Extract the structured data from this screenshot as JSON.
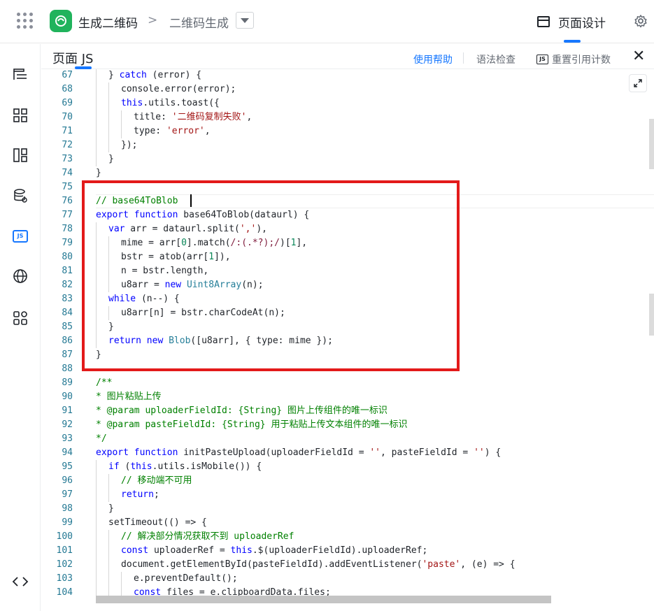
{
  "topbar": {
    "app_name": "生成二维码",
    "breadcrumb_sep": ">",
    "page_name": "二维码生成",
    "design_tab": "页面设计"
  },
  "editor": {
    "title": "页面 JS",
    "help": "使用帮助",
    "lint": "语法检查",
    "js_badge": "JS",
    "reset_ref": "重置引用计数"
  },
  "sidebar": {
    "items": [
      "outline-icon",
      "components-icon",
      "layout-icon",
      "datasource-icon",
      "js-icon",
      "globe-icon",
      "apps-icon",
      "code-icon"
    ],
    "js_label": "JS"
  },
  "colors": {
    "accent": "#1677ff",
    "logo": "#20b35c",
    "highlight_box": "#e31a1a"
  },
  "code_lines": [
    {
      "n": "67",
      "indent": 1,
      "tokens": [
        [
          "p",
          "} "
        ],
        [
          "kw",
          "catch"
        ],
        [
          "p",
          " (error) {"
        ]
      ]
    },
    {
      "n": "68",
      "indent": 2,
      "tokens": [
        [
          "p",
          "console.error(error);"
        ]
      ]
    },
    {
      "n": "69",
      "indent": 2,
      "tokens": [
        [
          "th",
          "this"
        ],
        [
          "p",
          ".utils.toast({"
        ]
      ]
    },
    {
      "n": "70",
      "indent": 3,
      "tokens": [
        [
          "p",
          "title: "
        ],
        [
          "str",
          "'二维码复制失败'"
        ],
        [
          "p",
          ","
        ]
      ]
    },
    {
      "n": "71",
      "indent": 3,
      "tokens": [
        [
          "p",
          "type: "
        ],
        [
          "str",
          "'error'"
        ],
        [
          "p",
          ","
        ]
      ]
    },
    {
      "n": "72",
      "indent": 2,
      "tokens": [
        [
          "p",
          "});"
        ]
      ]
    },
    {
      "n": "73",
      "indent": 1,
      "tokens": [
        [
          "p",
          "}"
        ]
      ]
    },
    {
      "n": "74",
      "indent": 0,
      "tokens": [
        [
          "p",
          "}"
        ]
      ]
    },
    {
      "n": "75",
      "indent": 0,
      "tokens": []
    },
    {
      "n": "76",
      "indent": 0,
      "tokens": [
        [
          "cm",
          "// base64ToBlob"
        ]
      ],
      "current": true
    },
    {
      "n": "77",
      "indent": 0,
      "tokens": [
        [
          "kw",
          "export"
        ],
        [
          "p",
          " "
        ],
        [
          "kw",
          "function"
        ],
        [
          "p",
          " base64ToBlob(dataurl) {"
        ]
      ]
    },
    {
      "n": "78",
      "indent": 1,
      "tokens": [
        [
          "kw",
          "var"
        ],
        [
          "p",
          " arr = dataurl.split("
        ],
        [
          "str",
          "','"
        ],
        [
          "p",
          "),"
        ]
      ]
    },
    {
      "n": "79",
      "indent": 2,
      "tokens": [
        [
          "p",
          "mime = arr["
        ],
        [
          "nm",
          "0"
        ],
        [
          "p",
          "].match("
        ],
        [
          "rx",
          "/:(.*?);/"
        ],
        [
          "p",
          ")["
        ],
        [
          "nm",
          "1"
        ],
        [
          "p",
          "],"
        ]
      ]
    },
    {
      "n": "80",
      "indent": 2,
      "tokens": [
        [
          "p",
          "bstr = atob(arr["
        ],
        [
          "nm",
          "1"
        ],
        [
          "p",
          "]),"
        ]
      ]
    },
    {
      "n": "81",
      "indent": 2,
      "tokens": [
        [
          "p",
          "n = bstr.length,"
        ]
      ]
    },
    {
      "n": "82",
      "indent": 2,
      "tokens": [
        [
          "p",
          "u8arr = "
        ],
        [
          "kw",
          "new"
        ],
        [
          "p",
          " "
        ],
        [
          "ty",
          "Uint8Array"
        ],
        [
          "p",
          "(n);"
        ]
      ]
    },
    {
      "n": "83",
      "indent": 1,
      "tokens": [
        [
          "kw",
          "while"
        ],
        [
          "p",
          " (n--) {"
        ]
      ]
    },
    {
      "n": "84",
      "indent": 2,
      "tokens": [
        [
          "p",
          "u8arr[n] = bstr.charCodeAt(n);"
        ]
      ]
    },
    {
      "n": "85",
      "indent": 1,
      "tokens": [
        [
          "p",
          "}"
        ]
      ]
    },
    {
      "n": "86",
      "indent": 1,
      "tokens": [
        [
          "kw",
          "return"
        ],
        [
          "p",
          " "
        ],
        [
          "kw",
          "new"
        ],
        [
          "p",
          " "
        ],
        [
          "ty",
          "Blob"
        ],
        [
          "p",
          "([u8arr], { type: mime });"
        ]
      ]
    },
    {
      "n": "87",
      "indent": 0,
      "tokens": [
        [
          "p",
          "}"
        ]
      ]
    },
    {
      "n": "88",
      "indent": 0,
      "tokens": []
    },
    {
      "n": "89",
      "indent": 0,
      "tokens": [
        [
          "cm",
          "/**"
        ]
      ]
    },
    {
      "n": "90",
      "indent": 0,
      "tokens": [
        [
          "cm",
          "* 图片粘贴上传"
        ]
      ]
    },
    {
      "n": "91",
      "indent": 0,
      "tokens": [
        [
          "cm",
          "* @param uploaderFieldId: {String} 图片上传组件的唯一标识"
        ]
      ]
    },
    {
      "n": "92",
      "indent": 0,
      "tokens": [
        [
          "cm",
          "* @param pasteFieldId: {String} 用于粘贴上传文本组件的唯一标识"
        ]
      ]
    },
    {
      "n": "93",
      "indent": 0,
      "tokens": [
        [
          "cm",
          "*/"
        ]
      ]
    },
    {
      "n": "94",
      "indent": 0,
      "tokens": [
        [
          "kw",
          "export"
        ],
        [
          "p",
          " "
        ],
        [
          "kw",
          "function"
        ],
        [
          "p",
          " initPasteUpload(uploaderFieldId = "
        ],
        [
          "str",
          "''"
        ],
        [
          "p",
          ", pasteFieldId = "
        ],
        [
          "str",
          "''"
        ],
        [
          "p",
          ") {"
        ]
      ]
    },
    {
      "n": "95",
      "indent": 1,
      "tokens": [
        [
          "kw",
          "if"
        ],
        [
          "p",
          " ("
        ],
        [
          "th",
          "this"
        ],
        [
          "p",
          ".utils.isMobile()) {"
        ]
      ]
    },
    {
      "n": "96",
      "indent": 2,
      "tokens": [
        [
          "cm",
          "// 移动端不可用"
        ]
      ]
    },
    {
      "n": "97",
      "indent": 2,
      "tokens": [
        [
          "kw",
          "return"
        ],
        [
          "p",
          ";"
        ]
      ]
    },
    {
      "n": "98",
      "indent": 1,
      "tokens": [
        [
          "p",
          "}"
        ]
      ]
    },
    {
      "n": "99",
      "indent": 1,
      "tokens": [
        [
          "p",
          "setTimeout(() => {"
        ]
      ]
    },
    {
      "n": "100",
      "indent": 2,
      "tokens": [
        [
          "cm",
          "// 解决部分情况获取不到 uploaderRef"
        ]
      ]
    },
    {
      "n": "101",
      "indent": 2,
      "tokens": [
        [
          "kw",
          "const"
        ],
        [
          "p",
          " uploaderRef = "
        ],
        [
          "th",
          "this"
        ],
        [
          "p",
          ".$(uploaderFieldId).uploaderRef;"
        ]
      ]
    },
    {
      "n": "102",
      "indent": 2,
      "tokens": [
        [
          "p",
          "document.getElementById(pasteFieldId).addEventListener("
        ],
        [
          "str",
          "'paste'"
        ],
        [
          "p",
          ", (e) => {"
        ]
      ]
    },
    {
      "n": "103",
      "indent": 3,
      "tokens": [
        [
          "p",
          "e.preventDefault();"
        ]
      ]
    },
    {
      "n": "104",
      "indent": 3,
      "tokens": [
        [
          "kw",
          "const"
        ],
        [
          "p",
          " files = e.clipboardData.files;"
        ]
      ]
    }
  ]
}
